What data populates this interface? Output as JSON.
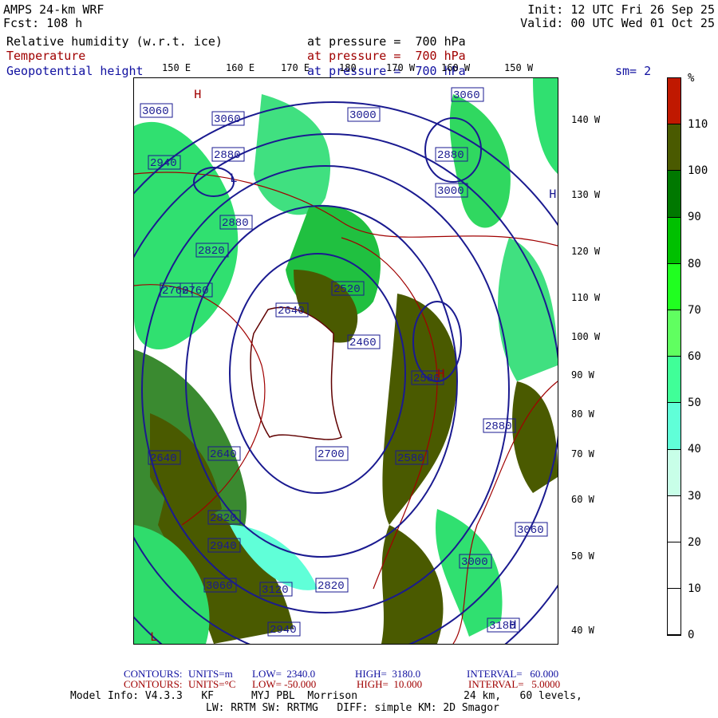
{
  "header": {
    "model": "AMPS 24-km WRF",
    "forecast": "Fcst: 108 h",
    "init": "Init: 12 UTC Fri 26 Sep 25",
    "valid": "Valid: 00 UTC Wed 01 Oct 25",
    "fields": [
      {
        "name": "Relative humidity (w.r.t. ice)",
        "level": "at pressure =  700 hPa",
        "color": "#000000"
      },
      {
        "name": "Temperature",
        "level": "at pressure =  700 hPa",
        "color": "#a00000"
      },
      {
        "name": "Geopotential height",
        "level": "at pressure =  700 hPa",
        "color": "#1010a0"
      }
    ],
    "smoothing": "sm= 2"
  },
  "map": {
    "lon_labels": [
      "150 E",
      "160 E",
      "170 E",
      "180",
      "170 W",
      "160 W",
      "150 W"
    ],
    "lat_labels": [
      "140 W",
      "130 W",
      "120 W",
      "110 W",
      "100 W",
      "90 W",
      "80 W",
      "70 W",
      "60 W",
      "50 W",
      "40 W"
    ],
    "height_labels": [
      "3060",
      "3060",
      "3000",
      "3060",
      "2880",
      "2940",
      "2880",
      "2760",
      "3000",
      "2880",
      "2820",
      "2760",
      "2520",
      "2640",
      "2460",
      "2580",
      "2640",
      "2700",
      "2640",
      "2580",
      "2820",
      "2940",
      "3060",
      "3120",
      "2940",
      "2820",
      "3000",
      "3060",
      "2880",
      "3180"
    ],
    "pressure_centers": [
      "H",
      "H",
      "L",
      "H",
      "L",
      "H"
    ]
  },
  "colorbar": {
    "unit": "%",
    "labels": [
      "110",
      "100",
      "90",
      "80",
      "70",
      "60",
      "50",
      "40",
      "30",
      "20",
      "10",
      "0"
    ],
    "colors": [
      "#c01800",
      "#4a5a00",
      "#007800",
      "#00c000",
      "#20ff20",
      "#60ff60",
      "#40ff98",
      "#60ffd8",
      "#c8ffe8",
      "#ffffff",
      "#ffffff",
      "#ffffff",
      "#ffffff"
    ]
  },
  "footer": {
    "height_contours": {
      "label": "CONTOURS:",
      "units": "UNITS=m",
      "low": "LOW=  2340.0",
      "high": "HIGH=  3180.0",
      "interval": "INTERVAL=   60.000"
    },
    "temp_contours": {
      "label": "CONTOURS:",
      "units": "UNITS=°C",
      "low": "LOW= -50.000",
      "high": "HIGH=  10.000",
      "interval": "INTERVAL=   5.0000"
    },
    "model_info": "Model Info: V4.3.3   KF      MYJ PBL  Morrison                 24 km,   60 levels,",
    "physics": "LW: RRTM SW: RRTMG   DIFF: simple KM: 2D Smagor"
  }
}
